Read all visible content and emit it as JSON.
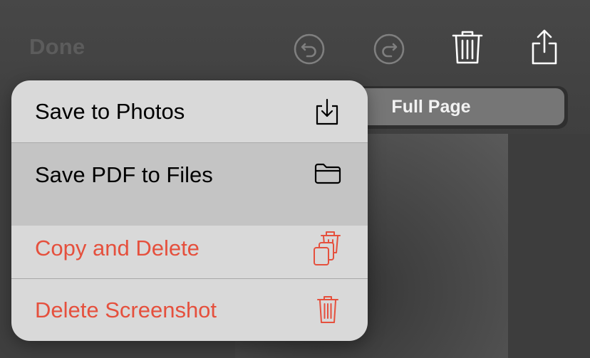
{
  "toolbar": {
    "done_label": "Done",
    "undo_icon": "undo-icon",
    "redo_icon": "redo-icon",
    "trash_icon": "trash-icon",
    "share_icon": "share-icon"
  },
  "segmented_control": {
    "selected_label": "Full Page"
  },
  "menu": {
    "items": [
      {
        "label": "Save to Photos",
        "icon": "save-to-photos-icon",
        "color": "#000000"
      },
      {
        "label": "Save PDF to Files",
        "icon": "folder-icon",
        "color": "#000000",
        "highlighted": true
      },
      {
        "label": "Copy and Delete",
        "icon": "copy-and-delete-icon",
        "color": "#e5503d"
      },
      {
        "label": "Delete Screenshot",
        "icon": "trash-icon",
        "color": "#e5503d"
      }
    ]
  },
  "colors": {
    "destructive": "#e5503d",
    "menu_background": "#d9d9d9",
    "menu_highlight": "#c4c4c4",
    "toolbar_background": "#454545"
  }
}
